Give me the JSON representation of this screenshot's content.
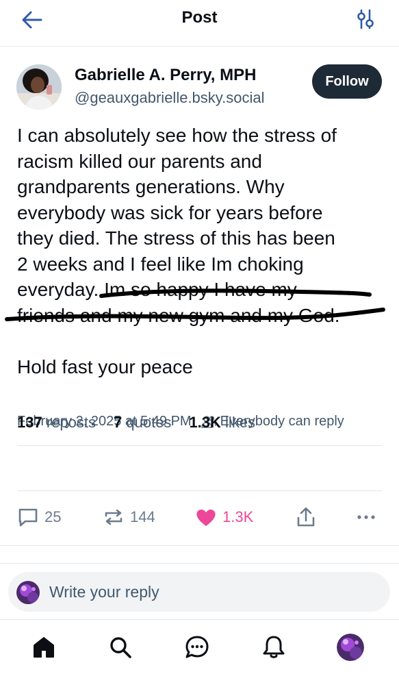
{
  "header": {
    "title": "Post",
    "back_icon": "arrow-left-icon",
    "filter_icon": "sliders-icon"
  },
  "post": {
    "author_name": "Gabrielle A. Perry, MPH",
    "author_handle": "@geauxgabrielle.bsky.social",
    "follow_label": "Follow",
    "body_lines": [
      "I can absolutely see how the stress of",
      "racism killed our parents and",
      "grandparents generations. Why",
      "everybody was sick for years before",
      "they died. The stress of this has been",
      "2 weeks and I feel like Im choking",
      "everyday. Im so happy I have my",
      "friends and my new gym and my God."
    ],
    "body_p2": "Hold fast your peace",
    "timestamp": "February 2, 2025 at 5:49 PM",
    "reply_setting": "Everybody can reply",
    "reposts_count": "137",
    "reposts_label": "reposts",
    "quotes_count": "7",
    "quotes_label": "quotes",
    "likes_count": "1.3K",
    "likes_label": "likes",
    "actions": {
      "reply_count": "25",
      "repost_count": "144",
      "like_count": "1.3K"
    }
  },
  "reply": {
    "placeholder": "Write your reply"
  },
  "colors": {
    "accent_dark": "#1f2a37",
    "muted": "#42576c",
    "like_pink": "#ec4899",
    "divider": "#e3e7ec"
  },
  "nav": [
    "home-icon",
    "search-icon",
    "chat-icon",
    "bell-icon",
    "profile-avatar"
  ]
}
